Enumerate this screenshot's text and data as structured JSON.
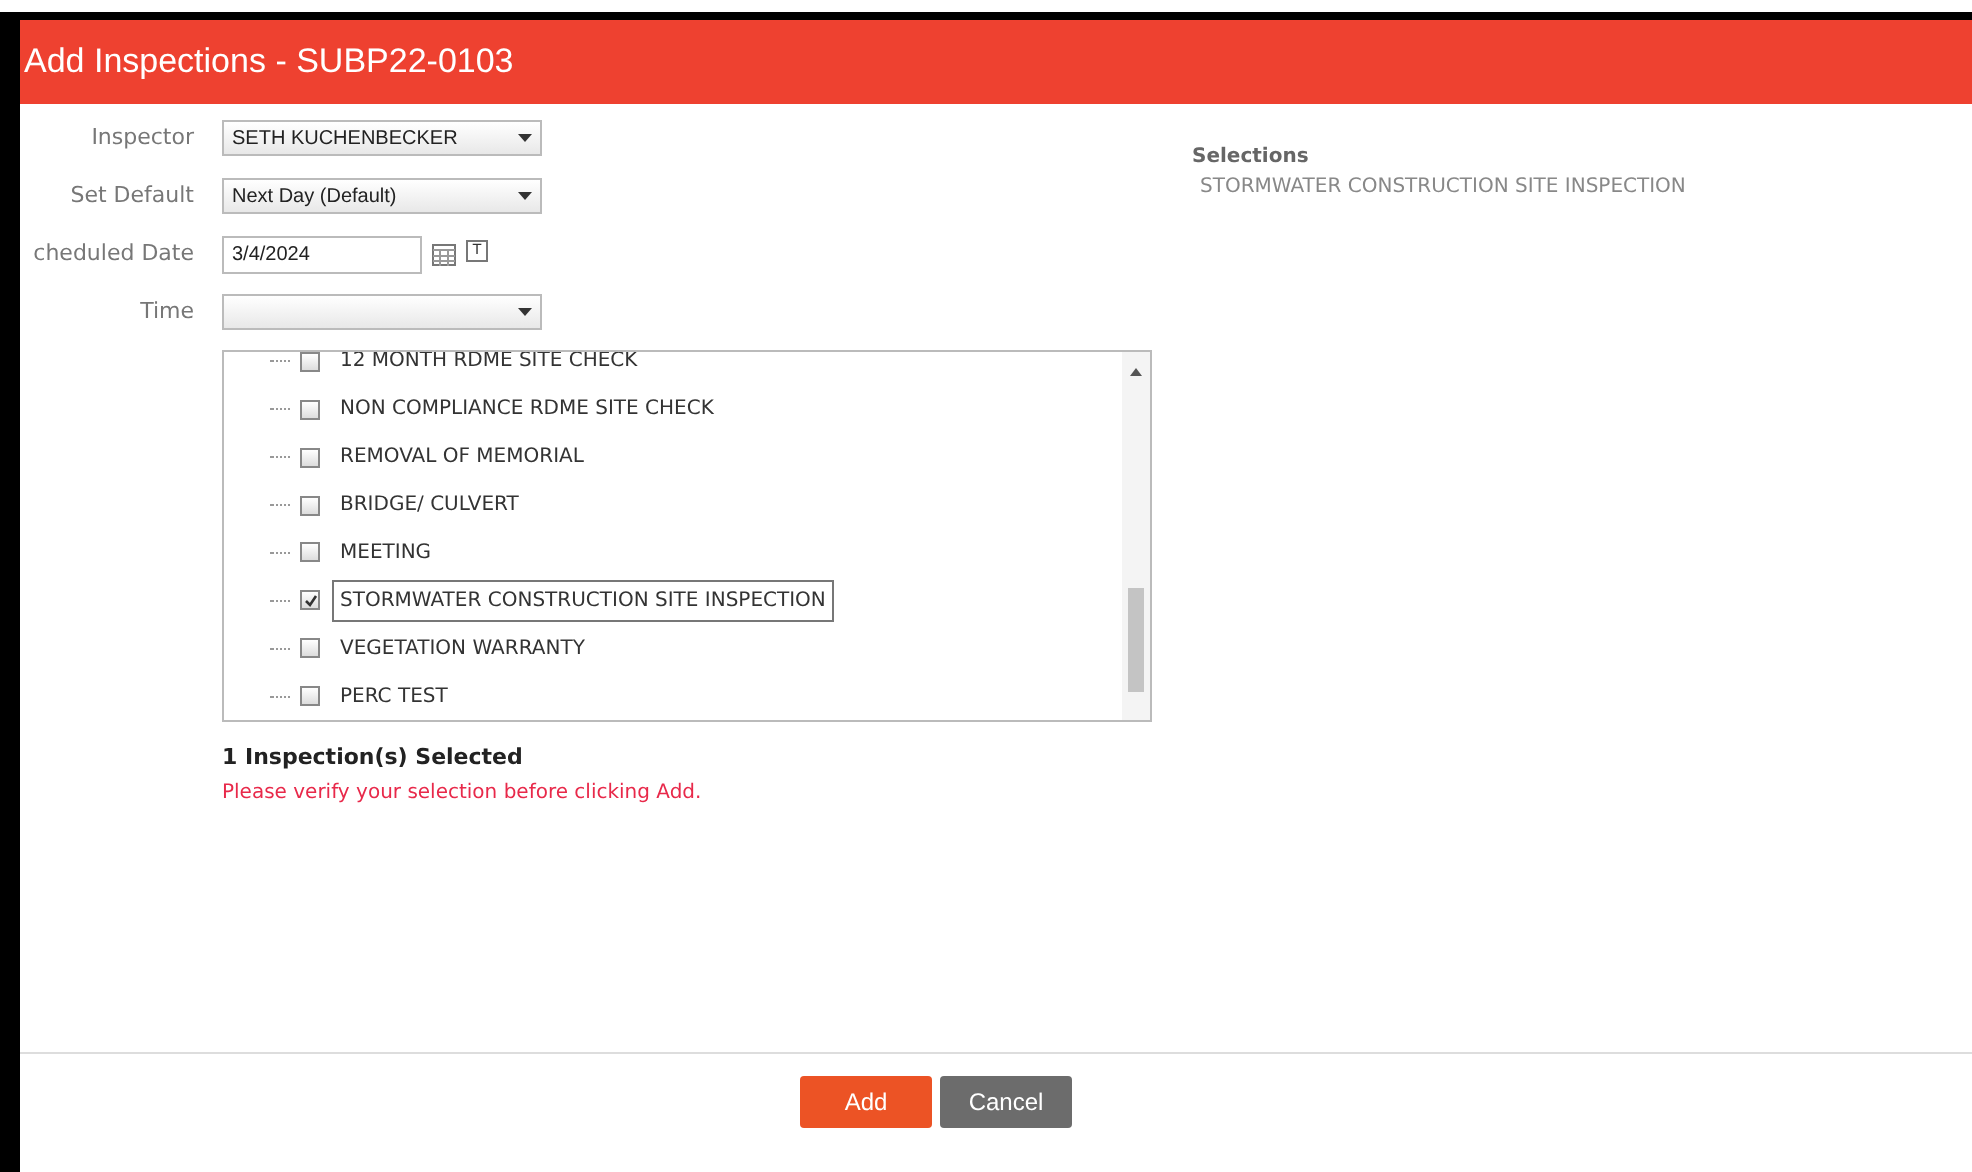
{
  "dialog": {
    "title": "Add Inspections - SUBP22-0103"
  },
  "form": [
    {
      "label": "Inspector",
      "kind": "select",
      "value": "SETH KUCHENBECKER"
    },
    {
      "label": "Set Default",
      "kind": "select",
      "value": "Next Day (Default)"
    },
    {
      "label": "cheduled Date",
      "kind": "date",
      "value": "3/4/2024",
      "today_button": "T"
    },
    {
      "label": "Time",
      "kind": "select"
    }
  ],
  "inspection_tree": {
    "items": [
      {
        "label": "12 MONTH RDME SITE CHECK",
        "checked": false,
        "focused": false
      },
      {
        "label": "NON COMPLIANCE RDME SITE CHECK",
        "checked": false,
        "focused": false
      },
      {
        "label": "REMOVAL OF MEMORIAL",
        "checked": false,
        "focused": false
      },
      {
        "label": "BRIDGE/ CULVERT",
        "checked": false,
        "focused": false
      },
      {
        "label": "MEETING",
        "checked": false,
        "focused": false
      },
      {
        "label": "STORMWATER CONSTRUCTION SITE INSPECTION",
        "checked": true,
        "focused": true
      },
      {
        "label": "VEGETATION WARRANTY",
        "checked": false,
        "focused": false
      },
      {
        "label": "PERC TEST",
        "checked": false,
        "focused": false
      }
    ]
  },
  "selected_count": "1 Inspection(s) Selected",
  "warning": "Please verify your selection before clicking Add.",
  "selections": {
    "heading": "Selections",
    "items": [
      "STORMWATER CONSTRUCTION SITE INSPECTION"
    ]
  },
  "buttons": [
    {
      "label": "Add",
      "kind": "primary"
    },
    {
      "label": "Cancel",
      "kind": "secondary"
    }
  ]
}
